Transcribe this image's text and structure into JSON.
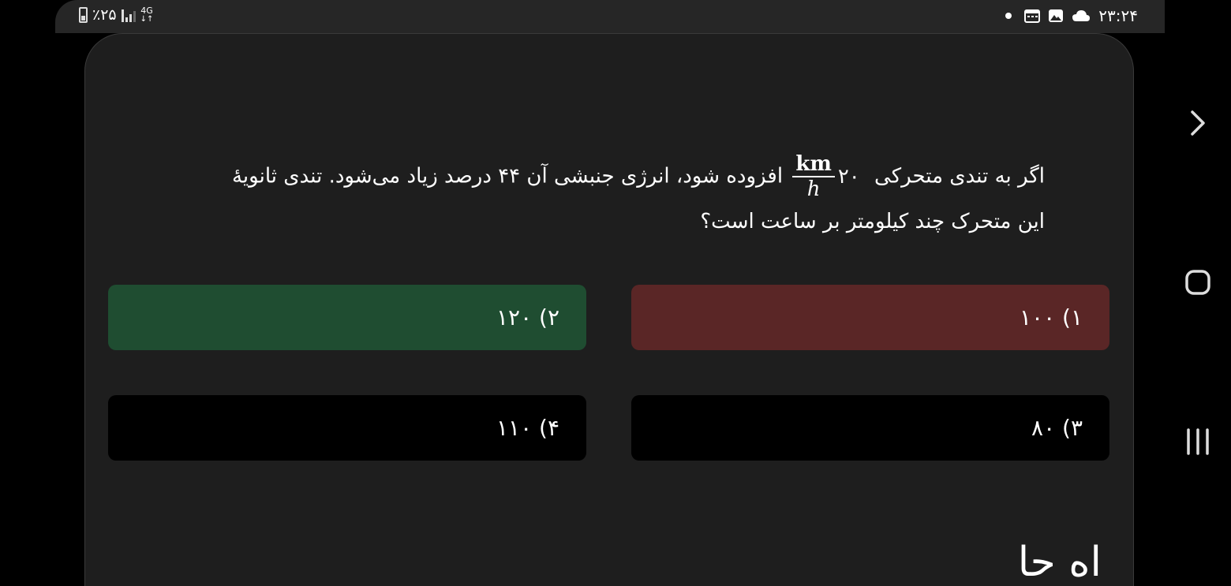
{
  "status_bar": {
    "battery_text": "٪۲۵",
    "network_type": "4G",
    "time": "۲۳:۲۴"
  },
  "question": {
    "part1": "اگر به تندی متحرکی",
    "speed_value": "۲۰",
    "unit_numerator": "km",
    "unit_denominator": "h",
    "part2": "افزوده شود، انرژی جنبشی آن ۴۴ درصد زیاد می‌شود. تندی ثانویهٔ این متحرک چند کیلومتر بر ساعت است؟"
  },
  "options": [
    {
      "label": "۱) ۱۰۰",
      "state": "wrong",
      "color": "#5a2626"
    },
    {
      "label": "۲) ۱۲۰",
      "state": "correct",
      "color": "#1f4d31"
    },
    {
      "label": "۳) ۸۰",
      "state": "neutral",
      "color": "#000000"
    },
    {
      "label": "۴) ۱۱۰",
      "state": "neutral",
      "color": "#000000"
    }
  ],
  "partial_heading": "اه حا",
  "nav": {
    "icons": [
      "chevron-right-icon",
      "home-icon",
      "recent-apps-icon"
    ]
  },
  "colors": {
    "background": "#000000",
    "card": "#1e1e1e",
    "status_bar": "#262626"
  }
}
